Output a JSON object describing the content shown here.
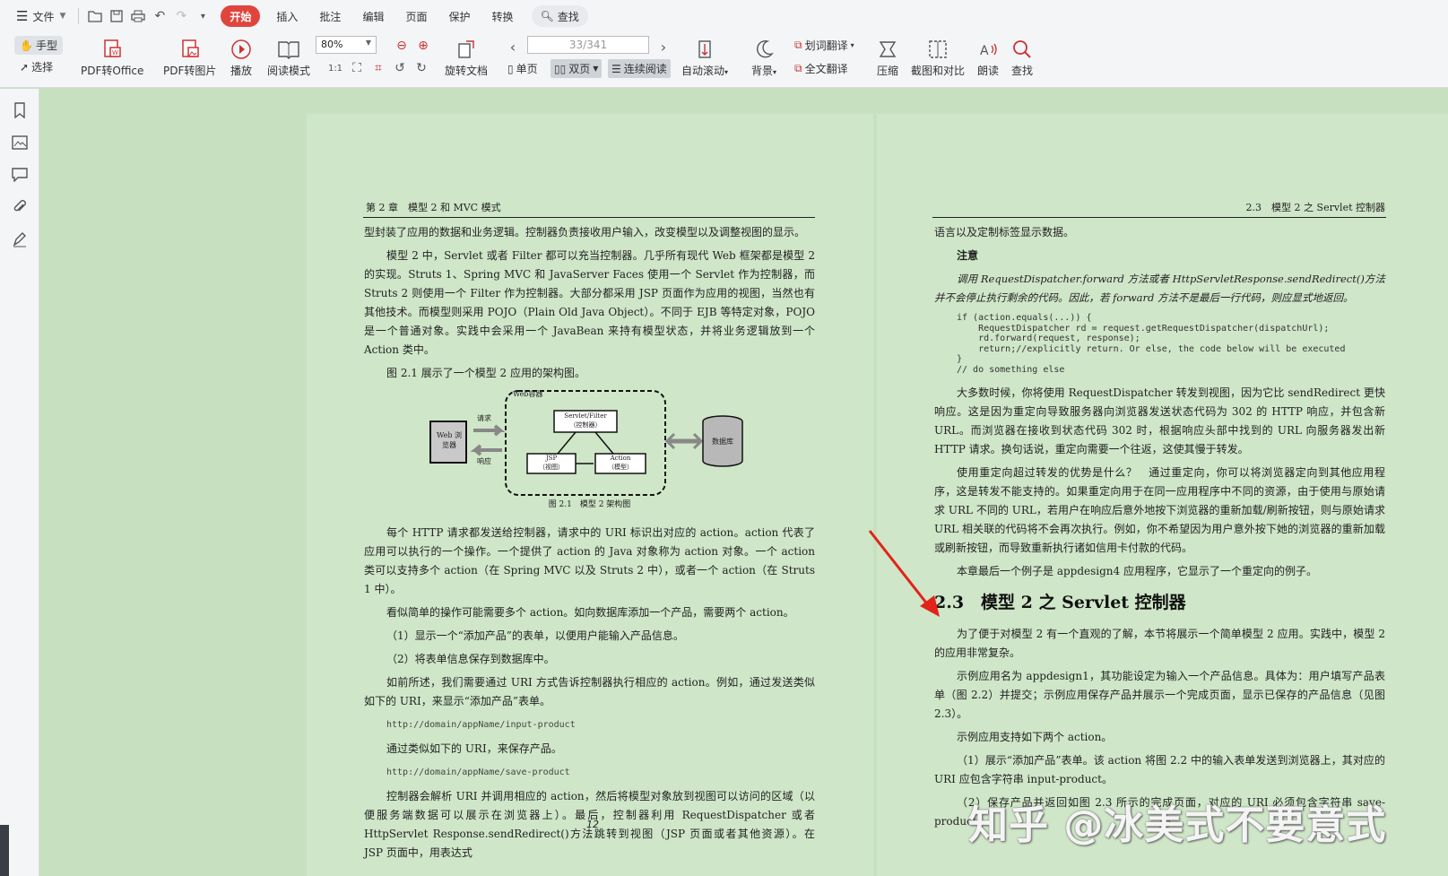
{
  "menu": {
    "file": "文件",
    "tabs": [
      "开始",
      "插入",
      "批注",
      "编辑",
      "页面",
      "保护",
      "转换"
    ],
    "search": "查找"
  },
  "toolbar": {
    "hand": "手型",
    "select": "选择",
    "pdf_office": "PDF转Office",
    "pdf_image": "PDF转图片",
    "play": "播放",
    "read_mode": "阅读模式",
    "zoom": "80%",
    "page_input": "33",
    "page_total": "/341",
    "rotate_doc": "旋转文档",
    "single": "单页",
    "double": "双页",
    "continuous": "连续阅读",
    "auto_scroll": "自动滚动",
    "background": "背景",
    "word_translate": "划词翻译",
    "full_translate": "全文翻译",
    "compress": "压缩",
    "screenshot_compare": "截图和对比",
    "read_aloud": "朗读",
    "find": "查找"
  },
  "left_page": {
    "header": "第 2 章　模型 2 和 MVC 模式",
    "p1": "型封装了应用的数据和业务逻辑。控制器负责接收用户输入，改变模型以及调整视图的显示。",
    "p2": "模型 2 中，Servlet 或者 Filter 都可以充当控制器。几乎所有现代 Web 框架都是模型 2 的实现。Struts 1、Spring MVC 和 JavaServer Faces 使用一个 Servlet 作为控制器，而 Struts 2 则使用一个 Filter 作为控制器。大部分都采用 JSP 页面作为应用的视图，当然也有其他技术。而模型则采用 POJO（Plain Old Java Object）。不同于 EJB 等特定对象，POJO 是一个普通对象。实践中会采用一个 JavaBean 来持有模型状态，并将业务逻辑放到一个 Action 类中。",
    "p3": "图 2.1 展示了一个模型 2 应用的架构图。",
    "figure": {
      "web_container": "Web容器",
      "browser": "Web 浏览器",
      "request": "请求",
      "response": "响应",
      "servlet": "Servlet/Filter",
      "servlet_sub": "（控制器）",
      "jsp": "JSP",
      "jsp_sub": "（视图）",
      "action": "Action",
      "action_sub": "（模型）",
      "db": "数据库",
      "caption": "图 2.1　模型 2 架构图"
    },
    "p4": "每个 HTTP 请求都发送给控制器，请求中的 URI 标识出对应的 action。action 代表了应用可以执行的一个操作。一个提供了 action 的 Java 对象称为 action 对象。一个 action 类可以支持多个 action（在 Spring MVC 以及 Struts 2 中），或者一个 action（在 Struts 1 中）。",
    "p5": "看似简单的操作可能需要多个 action。如向数据库添加一个产品，需要两个 action。",
    "p6": "（1）显示一个“添加产品”的表单，以便用户能输入产品信息。",
    "p7": "（2）将表单信息保存到数据库中。",
    "p8": "如前所述，我们需要通过 URI 方式告诉控制器执行相应的 action。例如，通过发送类似如下的 URI，来显示“添加产品”表单。",
    "url1": "http://domain/appName/input-product",
    "p9": "通过类似如下的 URI，来保存产品。",
    "url2": "http://domain/appName/save-product",
    "p10": "控制器会解析 URI 并调用相应的 action，然后将模型对象放到视图可以访问的区域（以便服务端数据可以展示在浏览器上）。最后，控制器利用 RequestDispatcher 或者 HttpServlet Response.sendRedirect()方法跳转到视图（JSP 页面或者其他资源）。在　JSP 页面中，用表达式",
    "page_no": "12"
  },
  "right_page": {
    "header": "2.3　模型 2 之 Servlet 控制器",
    "p1": "语言以及定制标签显示数据。",
    "note_title": "注意",
    "note": "调用 RequestDispatcher.forward 方法或者 HttpServletResponse.sendRedirect()方法并不会停止执行剩余的代码。因此，若 forward 方法不是最后一行代码，则应显式地返回。",
    "code": "if (action.equals(...)) {\n    RequestDispatcher rd = request.getRequestDispatcher(dispatchUrl);\n    rd.forward(request, response);\n    return;//explicitly return. Or else, the code below will be executed\n}\n// do something else",
    "p2": "大多数时候，你将使用 RequestDispatcher 转发到视图，因为它比 sendRedirect 更快响应。这是因为重定向导致服务器向浏览器发送状态代码为 302 的 HTTP 响应，并包含新 URL。而浏览器在接收到状态代码 302 时，根据响应头部中找到的 URL 向服务器发出新 HTTP 请求。换句话说，重定向需要一个往返，这使其慢于转发。",
    "p3": "使用重定向超过转发的优势是什么？　通过重定向，你可以将浏览器定向到其他应用程序，这是转发不能支持的。如果重定向用于在同一应用程序中不同的资源，由于使用与原始请求 URL 不同的 URL，若用户在响应后意外地按下浏览器的重新加载/刷新按钮，则与原始请求 URL 相关联的代码将不会再次执行。例如，你不希望因为用户意外按下她的浏览器的重新加载或刷新按钮，而导致重新执行诸如信用卡付款的代码。",
    "p4": "本章最后一个例子是 appdesign4 应用程序，它显示了一个重定向的例子。",
    "h2": "2.3　模型 2 之 Servlet 控制器",
    "p5": "为了便于对模型 2 有一个直观的了解，本节将展示一个简单模型 2 应用。实践中，模型 2 的应用非常复杂。",
    "p6": "示例应用名为 appdesign1，其功能设定为输入一个产品信息。具体为：用户填写产品表单（图 2.2）并提交；示例应用保存产品并展示一个完成页面，显示已保存的产品信息（见图 2.3）。",
    "p7": "示例应用支持如下两个 action。",
    "p8": "（1）展示“添加产品”表单。该 action 将图 2.2 中的输入表单发送到浏览器上，其对应的 URI 应包含字符串 input-product。",
    "p9": "（2）保存产品并返回如图 2.3 所示的完成页面，对应的 URI 必须包含字符串 save-product。",
    "page_no": "13"
  },
  "watermark": "知乎 @冰美式不要意式"
}
